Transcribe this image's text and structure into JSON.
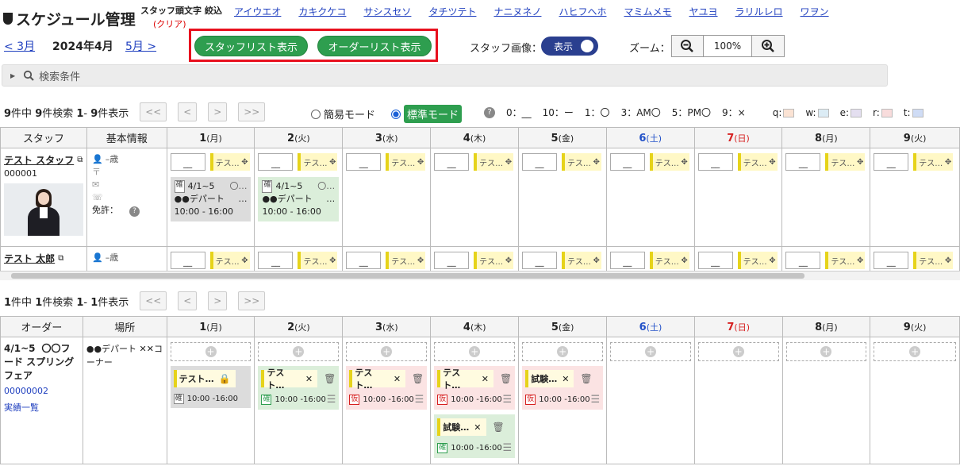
{
  "header": {
    "title": "スケジュール管理",
    "initial_label": "スタッフ頭文字 絞込",
    "clear": "(クリア)",
    "kana": [
      "アイウエオ",
      "カキクケコ",
      "サシスセソ",
      "タチツテト",
      "ナニヌネノ",
      "ハヒフヘホ",
      "マミムメモ",
      "ヤユヨ",
      "ラリルレロ",
      "ワヲン"
    ]
  },
  "nav": {
    "prev": "< 3月",
    "current": "2024年4月",
    "next": "5月 >",
    "staff_list_btn": "スタッフリスト表示",
    "order_list_btn": "オーダーリスト表示",
    "staff_image_label": "スタッフ画像：",
    "staff_image_toggle": "表示",
    "zoom_label": "ズーム：",
    "zoom_value": "100%",
    "search_label": "検索条件"
  },
  "staff_paging": {
    "total": "9",
    "found": "9",
    "from": "1",
    "to": "9",
    "t1": "件中 ",
    "t2": "件検索 ",
    "t3": "- ",
    "t4": "件表示"
  },
  "order_paging": {
    "total": "1",
    "found": "1",
    "from": "1",
    "to": "1",
    "t1": "件中 ",
    "t2": "件検索 ",
    "t3": "- ",
    "t4": "件表示"
  },
  "paging_buttons": [
    "<<",
    "<",
    ">",
    ">>"
  ],
  "mode": {
    "simple": "簡易モード",
    "standard": "標準モード"
  },
  "legend": [
    "0：__",
    "10：ー",
    "1：〇",
    "3：AM〇",
    "5：PM〇",
    "9：×"
  ],
  "color_legend": [
    "q:",
    "w:",
    "e:",
    "r:",
    "t:"
  ],
  "colors": {
    "accent_green": "#2e9e4f",
    "toggle_navy": "#2a3f8f",
    "highlight_red": "#e8101e",
    "q": "#fbe3d4",
    "w": "#dcecf5",
    "e": "#e4dff0",
    "r": "#f8dcdc",
    "t": "#cfdcf5"
  },
  "days": [
    {
      "n": "1",
      "w": "(月)",
      "c": ""
    },
    {
      "n": "2",
      "w": "(火)",
      "c": ""
    },
    {
      "n": "3",
      "w": "(水)",
      "c": ""
    },
    {
      "n": "4",
      "w": "(木)",
      "c": ""
    },
    {
      "n": "5",
      "w": "(金)",
      "c": ""
    },
    {
      "n": "6",
      "w": "(土)",
      "c": "blue"
    },
    {
      "n": "7",
      "w": "(日)",
      "c": "red"
    },
    {
      "n": "8",
      "w": "(月)",
      "c": ""
    },
    {
      "n": "9",
      "w": "(火)",
      "c": ""
    }
  ],
  "staff_table": {
    "col_staff": "スタッフ",
    "col_info": "基本情報",
    "cell_dash": "__",
    "cell_tag": "テス…",
    "staff": [
      {
        "name": "テスト スタッフ",
        "id": "000001",
        "age": "–歳",
        "license": "免許："
      },
      {
        "name": "テスト 太郎",
        "age": "–歳"
      }
    ],
    "shifts": [
      {
        "day": 0,
        "color": "gray",
        "badge": "確",
        "period": "4/1~5",
        "extra": "〇…",
        "place": "●●デパート",
        "ellipsis": "…",
        "time": "10:00 - 16:00"
      },
      {
        "day": 1,
        "color": "green",
        "badge": "確",
        "period": "4/1~5",
        "extra": "〇…",
        "place": "●●デパート",
        "ellipsis": "…",
        "time": "10:00 - 16:00"
      }
    ]
  },
  "order_table": {
    "col_order": "オーダー",
    "col_place": "場所",
    "order": {
      "period": "4/1~5",
      "name": "〇〇フード スプリングフェア",
      "id": "00000002",
      "link": "実績一覧",
      "place": "●●デパート ✕✕コーナー"
    },
    "add_symbol": "+",
    "cards": [
      {
        "day": 0,
        "color": "gray",
        "tag": "テスト…",
        "badge": "確",
        "time": "10:00 -16:00",
        "locked": true
      },
      {
        "day": 1,
        "color": "green",
        "tag": "テスト…",
        "badge": "確",
        "time": "10:00 -16:00",
        "locked": false
      },
      {
        "day": 2,
        "color": "pink",
        "tag": "テスト…",
        "badge": "仮",
        "time": "10:00 -16:00",
        "locked": false
      },
      {
        "day": 3,
        "color": "pink",
        "tag": "テスト…",
        "badge": "仮",
        "time": "10:00 -16:00",
        "locked": false
      },
      {
        "day": 3,
        "color": "green",
        "tag": "試験…",
        "badge": "確",
        "time": "10:00 -16:00",
        "locked": false
      },
      {
        "day": 4,
        "color": "pink",
        "tag": "試験…",
        "badge": "仮",
        "time": "10:00 -16:00",
        "locked": false
      }
    ]
  }
}
